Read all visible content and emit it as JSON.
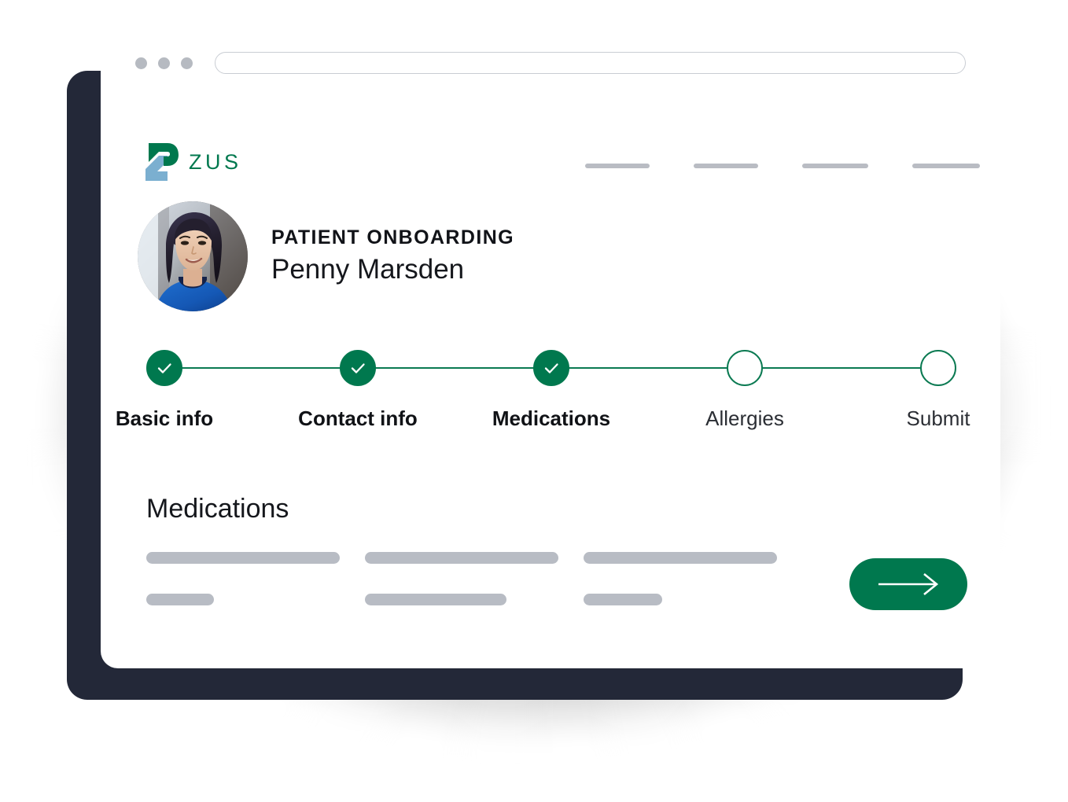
{
  "browser": {
    "window_controls": [
      "close-dot",
      "minimize-dot",
      "maximize-dot"
    ],
    "address_bar_value": "",
    "address_bar_placeholder": ""
  },
  "brand": {
    "logo_icon": "zus-z-logo-icon",
    "wordmark": "ZUS",
    "green": "#00784E",
    "blue": "#7BAFD0"
  },
  "nav": {
    "items": [
      {
        "label": ""
      },
      {
        "label": ""
      },
      {
        "label": ""
      },
      {
        "label": ""
      }
    ]
  },
  "patient": {
    "avatar_icon": "patient-avatar-photo",
    "eyebrow": "PATIENT ONBOARDING",
    "name": "Penny Marsden"
  },
  "stepper": {
    "steps": [
      {
        "label": "Basic info",
        "state": "done",
        "icon": "check-icon"
      },
      {
        "label": "Contact info",
        "state": "done",
        "icon": "check-icon"
      },
      {
        "label": "Medications",
        "state": "done",
        "icon": "check-icon"
      },
      {
        "label": "Allergies",
        "state": "todo",
        "icon": ""
      },
      {
        "label": "Submit",
        "state": "todo",
        "icon": ""
      }
    ]
  },
  "section": {
    "title": "Medications",
    "fields": [
      {
        "line_long": "",
        "line_short": ""
      },
      {
        "line_long": "",
        "line_short": ""
      },
      {
        "line_long": "",
        "line_short": ""
      }
    ]
  },
  "actions": {
    "next_label": "",
    "next_icon": "arrow-right-icon"
  },
  "theme": {
    "accent_green": "#00784E",
    "track_green": "#0B7A52",
    "placeholder_gray": "#B8BCC4",
    "back_card_navy": "#232838",
    "card_white": "#FFFFFF"
  }
}
